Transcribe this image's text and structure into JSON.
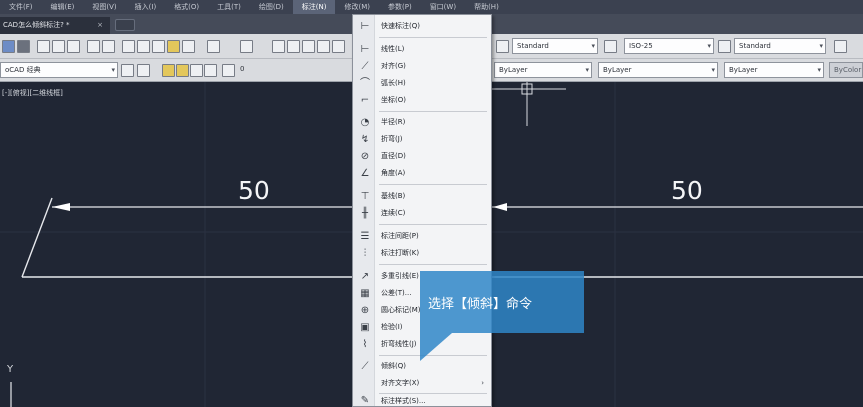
{
  "menubar": {
    "items": [
      "文件(F)",
      "编辑(E)",
      "视图(V)",
      "插入(I)",
      "格式(O)",
      "工具(T)",
      "绘图(D)",
      "标注(N)",
      "修改(M)",
      "参数(P)",
      "窗口(W)",
      "帮助(H)"
    ],
    "active_index": 7
  },
  "document_tab": {
    "title": "CAD怎么倾斜标注? *",
    "close_glyph": "×"
  },
  "toolbar": {
    "text_style": "Standard",
    "dim_style": "ISO-25",
    "table_style": "Standard",
    "workspace": "oCAD 经典",
    "layer_value": "0",
    "color_control": "ByLayer",
    "linetype_control": "ByLayer",
    "lineweight_control": "ByLayer",
    "plotstyle_control": "ByColor"
  },
  "canvas": {
    "viewport_label": "[-][俯视][二维线框]",
    "dimension_left": "50",
    "dimension_right": "50",
    "y_axis_label": "Y",
    "colors": {
      "background": "#202634",
      "geometry": "#e6e8ec"
    }
  },
  "dimension_menu": {
    "items": [
      {
        "label": "快速标注(Q)",
        "icon": "quick-dimension-icon"
      },
      {
        "label": "线性(L)",
        "icon": "linear-dimension-icon"
      },
      {
        "label": "对齐(G)",
        "icon": "aligned-dimension-icon"
      },
      {
        "label": "弧长(H)",
        "icon": "arc-length-icon"
      },
      {
        "label": "坐标(O)",
        "icon": "ordinate-icon"
      },
      {
        "label": "半径(R)",
        "icon": "radius-icon"
      },
      {
        "label": "折弯(J)",
        "icon": "jogged-icon"
      },
      {
        "label": "直径(D)",
        "icon": "diameter-icon"
      },
      {
        "label": "角度(A)",
        "icon": "angle-icon"
      },
      {
        "label": "基线(B)",
        "icon": "baseline-icon"
      },
      {
        "label": "连续(C)",
        "icon": "continue-icon"
      },
      {
        "label": "标注间距(P)",
        "icon": "dimension-space-icon"
      },
      {
        "label": "标注打断(K)",
        "icon": "dimension-break-icon"
      },
      {
        "label": "多重引线(E)",
        "icon": "multileader-icon"
      },
      {
        "label": "公差(T)...",
        "icon": "tolerance-icon"
      },
      {
        "label": "圆心标记(M)",
        "icon": "center-mark-icon"
      },
      {
        "label": "检验(I)",
        "icon": "inspection-icon"
      },
      {
        "label": "折弯线性(J)",
        "icon": "jogged-linear-icon"
      },
      {
        "label": "倾斜(Q)",
        "icon": "oblique-icon"
      },
      {
        "label": "对齐文字(X)",
        "icon": "none",
        "submenu": "›"
      },
      {
        "label": "标注样式(S)...",
        "icon": "dimension-style-icon"
      }
    ]
  },
  "callout": {
    "text": "选择【倾斜】命令",
    "color": "#2f86c8"
  }
}
